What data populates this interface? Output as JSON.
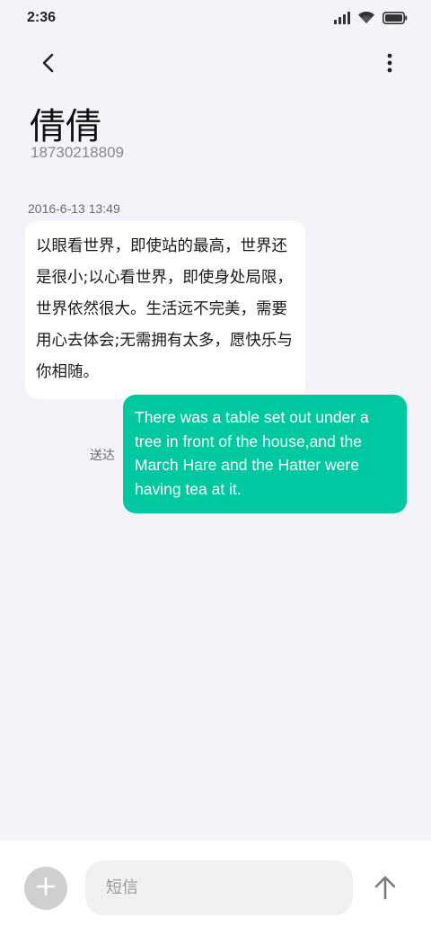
{
  "status_bar": {
    "time": "2:36",
    "icons": [
      "signal-icon",
      "wifi-icon",
      "battery-icon"
    ]
  },
  "header": {
    "back_icon": "chevron-left-icon",
    "more_icon": "more-vertical-icon",
    "contact_name": "倩倩",
    "contact_number": "18730218809"
  },
  "conversation": {
    "timestamp": "2016-6-13 13:49",
    "messages": [
      {
        "direction": "incoming",
        "text": "以眼看世界，即使站的最高，世界还是很小;以心看世界，即使身处局限，世界依然很大。生活远不完美，需要用心去体会;无需拥有太多，愿快乐与你相随。"
      },
      {
        "direction": "outgoing",
        "text": "There was a table set out under a tree in front of the house,and the March Hare and the Hatter were having tea at it.",
        "status": "送达"
      }
    ]
  },
  "composer": {
    "add_icon": "plus-icon",
    "placeholder": "短信",
    "send_icon": "arrow-up-icon"
  },
  "colors": {
    "background": "#f4f3f8",
    "incoming_bubble": "#ffffff",
    "outgoing_bubble": "#00c8a0",
    "add_button": "#cfcfcf"
  }
}
